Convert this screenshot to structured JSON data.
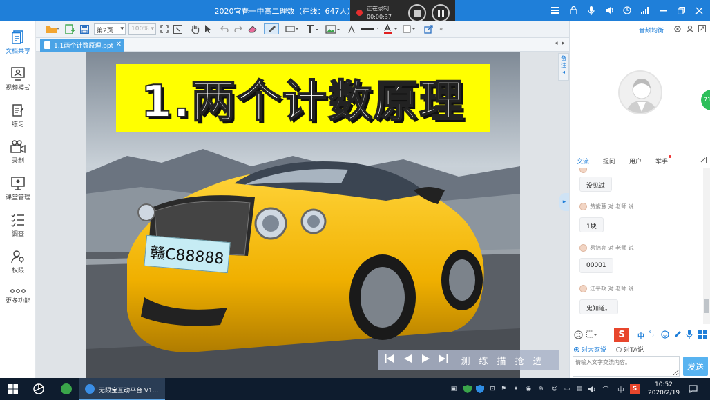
{
  "window": {
    "title": "2020宜春一中高二理数（在线：647人）"
  },
  "recording": {
    "status": "正在录制",
    "time": "00:00:37"
  },
  "sidebar": {
    "items": [
      {
        "label": "文档共享",
        "icon": "document-share-icon",
        "active": true
      },
      {
        "label": "视频模式",
        "icon": "video-mode-icon"
      },
      {
        "label": "练习",
        "icon": "exercise-icon"
      },
      {
        "label": "录制",
        "icon": "record-camera-icon"
      },
      {
        "label": "课堂管理",
        "icon": "classroom-manage-icon"
      },
      {
        "label": "调查",
        "icon": "survey-icon"
      },
      {
        "label": "权限",
        "icon": "permission-icon"
      },
      {
        "label": "更多功能",
        "icon": "more-icon"
      }
    ]
  },
  "toolbar": {
    "page_select": "第2页",
    "zoom_select": "100%"
  },
  "document": {
    "file_tab": "1.1两个计数原理.ppt"
  },
  "slide": {
    "title": "1.两个计数原理",
    "plate": "赣C88888"
  },
  "slide_nav": {
    "labels": [
      "测",
      "练",
      "描",
      "抢",
      "选"
    ]
  },
  "side_panel": {
    "notes_label": "备注"
  },
  "right_panel": {
    "audio_label": "音频均衡",
    "badge": "71",
    "chat_tabs": [
      "交流",
      "提问",
      "用户",
      "举手"
    ],
    "messages": [
      {
        "text": "没见过"
      },
      {
        "sender": "黄紫薏 对 老师 说",
        "text": "1块"
      },
      {
        "sender": "易锦亮 对 老师 说",
        "text": "00001"
      },
      {
        "sender": "江平政 对 老师 说",
        "text": "鬼知道。"
      }
    ],
    "audience_all": "对大家说",
    "audience_one": "对TA说",
    "input_placeholder": "请输入文字交流内容。",
    "send_label": "发送",
    "ime_label": "中"
  },
  "taskbar": {
    "app_label": "无限宝互动平台 V1...",
    "ime": "中",
    "time": "10:52",
    "date": "2020/2/19"
  },
  "colors": {
    "accent": "#1f7fd9",
    "slide_title_bg": "#ffff00",
    "car": "#f0b400",
    "taskbar": "#0e1c2e"
  }
}
